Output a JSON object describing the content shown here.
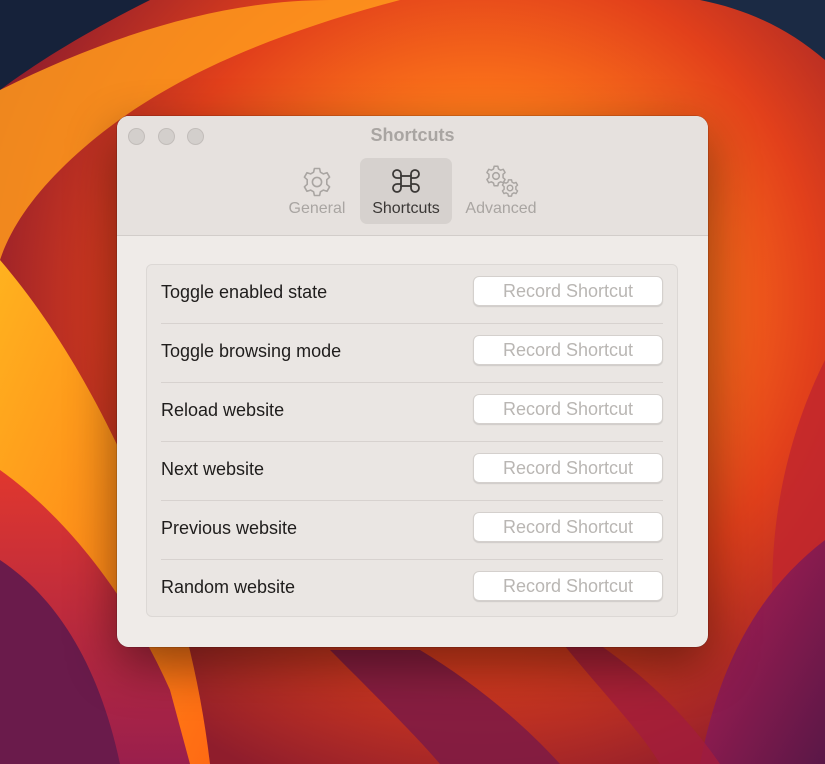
{
  "window": {
    "title": "Shortcuts"
  },
  "tabs": [
    {
      "label": "General",
      "icon": "gear-icon",
      "active": false
    },
    {
      "label": "Shortcuts",
      "icon": "command-icon",
      "active": true
    },
    {
      "label": "Advanced",
      "icon": "gears-icon",
      "active": false
    }
  ],
  "shortcuts": [
    {
      "label": "Toggle enabled state",
      "button": "Record Shortcut"
    },
    {
      "label": "Toggle browsing mode",
      "button": "Record Shortcut"
    },
    {
      "label": "Reload website",
      "button": "Record Shortcut"
    },
    {
      "label": "Next website",
      "button": "Record Shortcut"
    },
    {
      "label": "Previous website",
      "button": "Record Shortcut"
    },
    {
      "label": "Random website",
      "button": "Record Shortcut"
    }
  ],
  "colors": {
    "window_bg": "#efebe8",
    "active_tab_bg": "#d6d1ce",
    "inactive_text": "#a9a5a2",
    "placeholder_text": "#b9b6b3"
  }
}
